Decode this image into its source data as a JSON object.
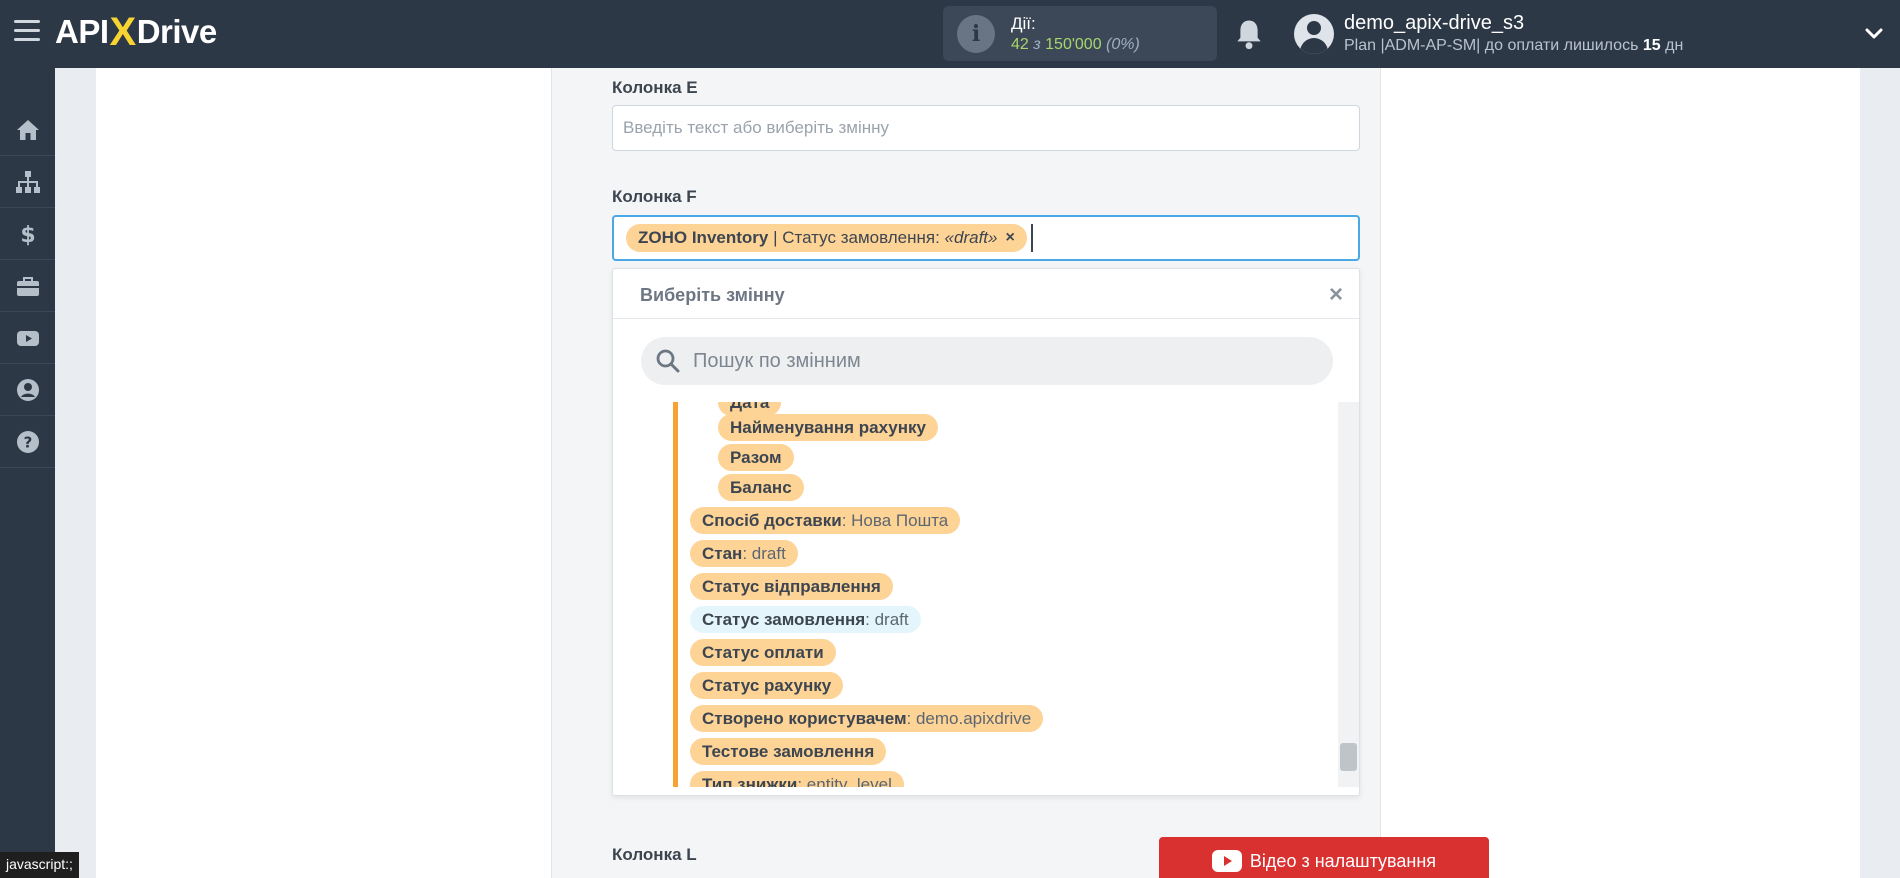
{
  "app": {
    "logo_left": "API",
    "logo_x": "X",
    "logo_right": "Drive"
  },
  "header": {
    "actions_label": "Дії:",
    "actions_used": "42",
    "actions_of": "з",
    "actions_total": "150'000",
    "actions_percent": "(0%)",
    "user_name": "demo_apix-drive_s3",
    "plan_text": "Plan |ADM-AP-SM| до оплати лишилось",
    "plan_days": "15",
    "plan_days_unit": "дн"
  },
  "sidebar": {
    "items": [
      "home-icon",
      "sitemap-icon",
      "dollar-icon",
      "briefcase-icon",
      "youtube-icon",
      "user-icon",
      "help-icon"
    ]
  },
  "form": {
    "col_e_label": "Колонка E",
    "col_e_placeholder": "Введіть текст або виберіть змінну",
    "col_f_label": "Колонка F",
    "col_f_tag_source": "ZOHO Inventory",
    "col_f_tag_field": "| Статус замовлення:",
    "col_f_tag_value": "«draft»",
    "col_f_tag_close": "×",
    "col_l_label": "Колонка L"
  },
  "dropdown": {
    "title": "Виберіть змінну",
    "close": "×",
    "search_placeholder": "Пошук по змінним",
    "items": [
      {
        "label": "Дата",
        "value": ""
      },
      {
        "label": "Найменування рахунку",
        "value": ""
      },
      {
        "label": "Разом",
        "value": ""
      },
      {
        "label": "Баланс",
        "value": ""
      },
      {
        "label": "Спосіб доставки",
        "value": ": Нова Пошта"
      },
      {
        "label": "Стан",
        "value": ": draft"
      },
      {
        "label": "Статус відправлення",
        "value": ""
      },
      {
        "label": "Статус замовлення",
        "value": ": draft"
      },
      {
        "label": "Статус оплати",
        "value": ""
      },
      {
        "label": "Статус рахунку",
        "value": ""
      },
      {
        "label": "Створено користувачем",
        "value": ": demo.apixdrive"
      },
      {
        "label": "Тестове замовлення",
        "value": ""
      },
      {
        "label": "Тип знижки",
        "value": ": entity_level"
      }
    ]
  },
  "video_button": {
    "label": "Відео з налаштування"
  },
  "status_tip": "javascript:;",
  "colors": {
    "topbar": "#2d3847",
    "accent_orange": "#f6a234",
    "chip_orange": "#fdd396",
    "chip_active": "#e4f6fc",
    "focus_blue": "#4aa8e6",
    "video_red": "#d93030",
    "actions_green": "#a7d66c"
  }
}
